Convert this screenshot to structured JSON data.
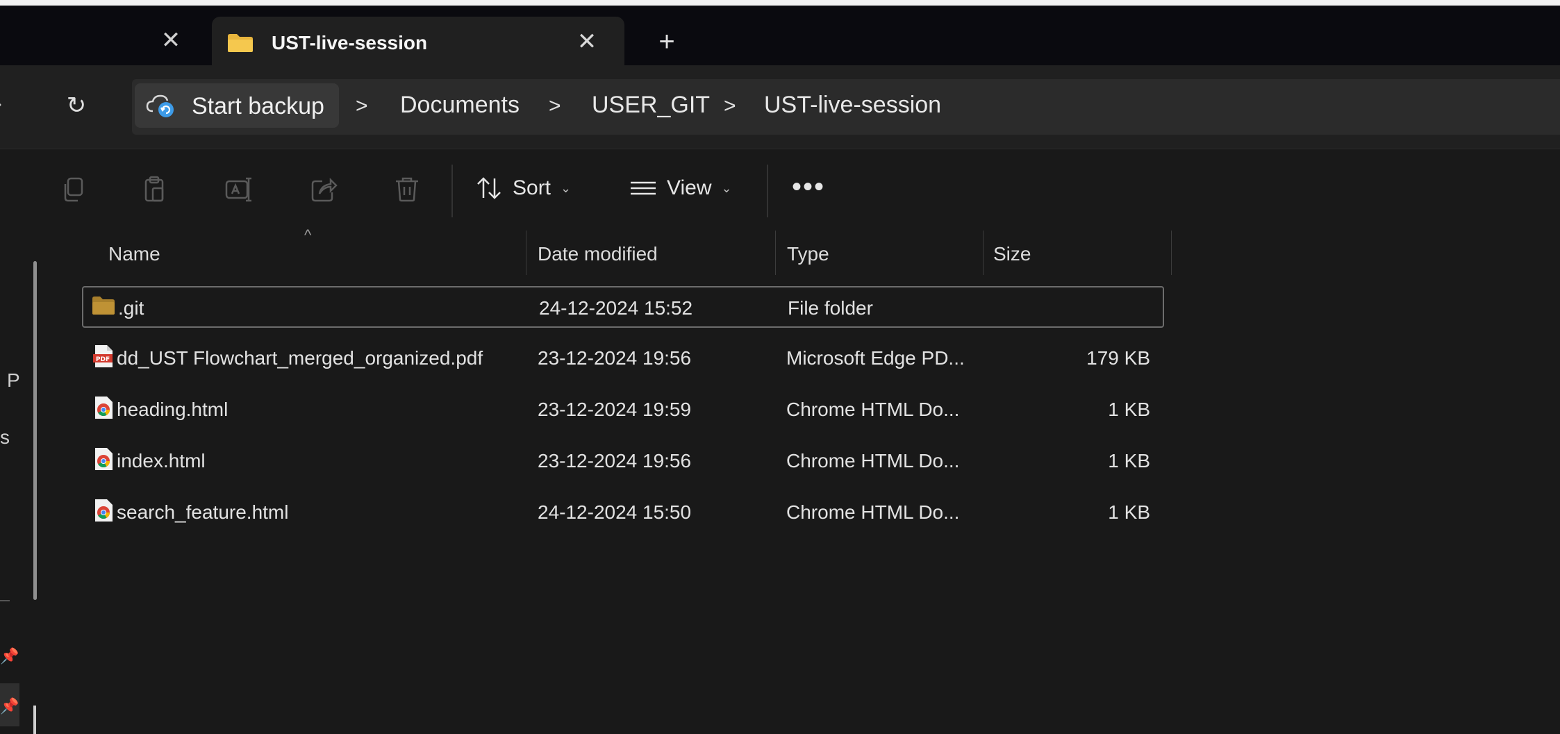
{
  "window": {
    "active_tab_title": "UST-live-session"
  },
  "address": {
    "backup_label": "Start backup",
    "breadcrumbs": [
      "Documents",
      "USER_GIT",
      "UST-live-session"
    ],
    "separator": ">"
  },
  "toolbar": {
    "sort_label": "Sort",
    "view_label": "View",
    "more_label": "•••"
  },
  "sidebar": {
    "partial_text_1": "P",
    "partial_text_2": "s"
  },
  "columns": {
    "name": "Name",
    "date_modified": "Date modified",
    "type": "Type",
    "size": "Size"
  },
  "files": [
    {
      "name": ".git",
      "date": "24-12-2024 15:52",
      "type": "File folder",
      "size": "",
      "icon": "folder-icon"
    },
    {
      "name": "dd_UST Flowchart_merged_organized.pdf",
      "date": "23-12-2024 19:56",
      "type": "Microsoft Edge PD...",
      "size": "179 KB",
      "icon": "pdf-icon"
    },
    {
      "name": "heading.html",
      "date": "23-12-2024 19:59",
      "type": "Chrome HTML Do...",
      "size": "1 KB",
      "icon": "chrome-html-icon"
    },
    {
      "name": "index.html",
      "date": "23-12-2024 19:56",
      "type": "Chrome HTML Do...",
      "size": "1 KB",
      "icon": "chrome-html-icon"
    },
    {
      "name": "search_feature.html",
      "date": "24-12-2024 15:50",
      "type": "Chrome HTML Do...",
      "size": "1 KB",
      "icon": "chrome-html-icon"
    }
  ],
  "colors": {
    "folder": "#d9a93a",
    "accent_backup": "#4aa3f0",
    "pdf_red": "#d33b2f"
  }
}
